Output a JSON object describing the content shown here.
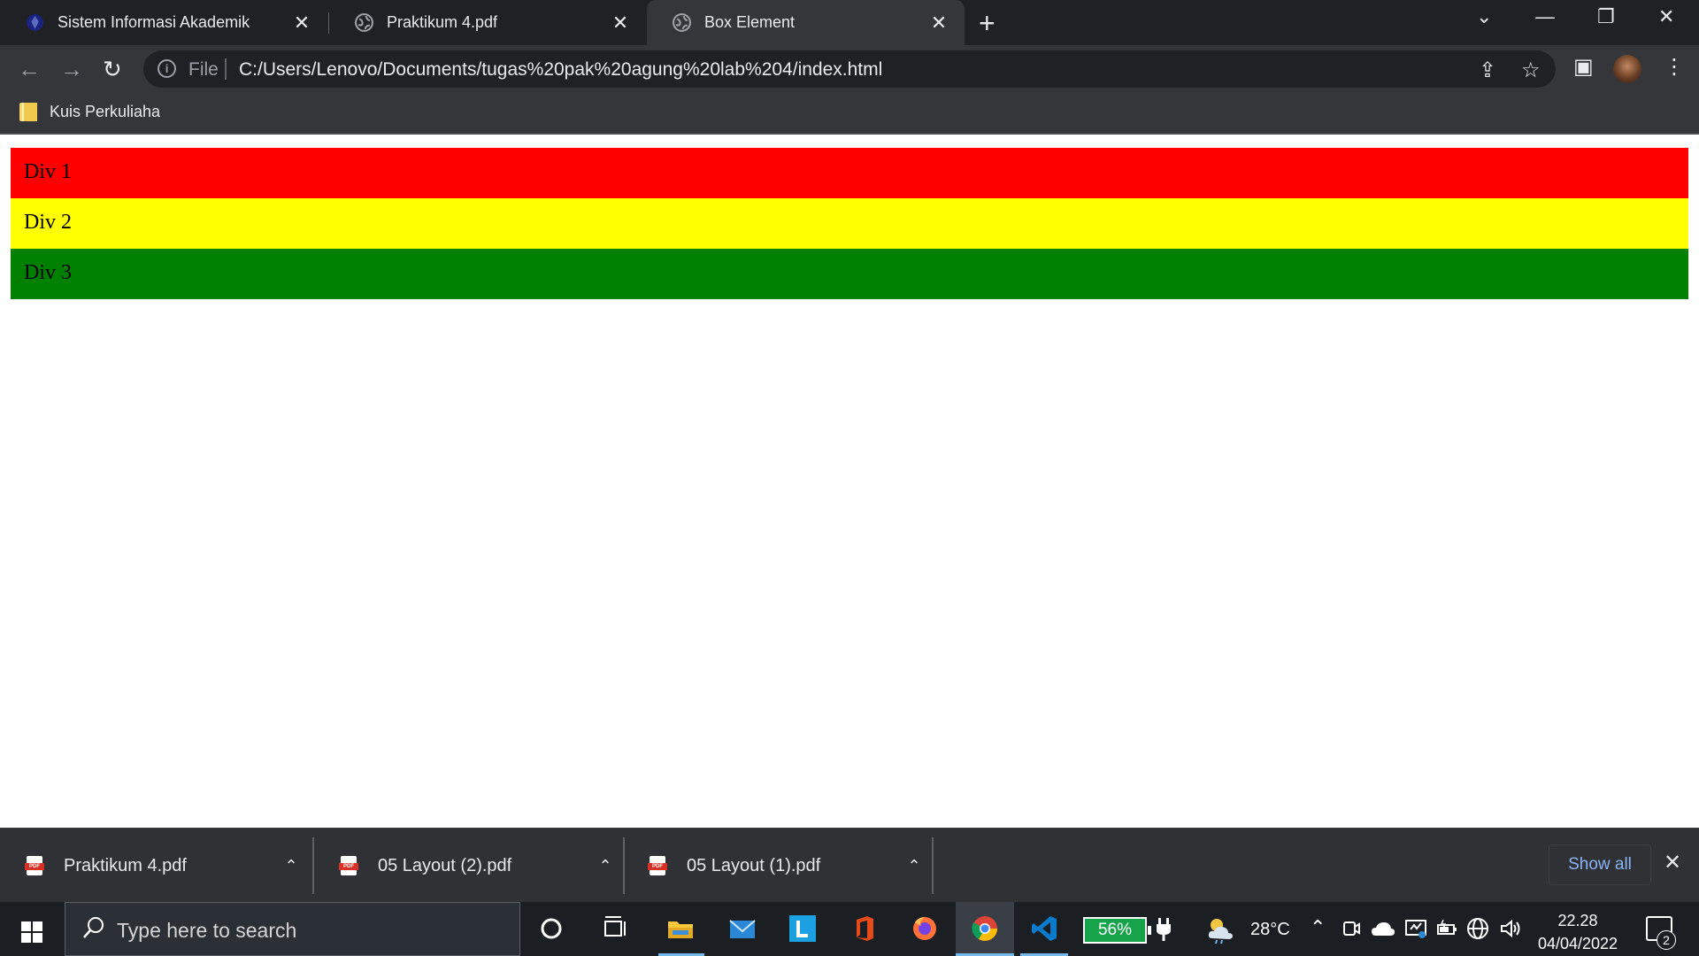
{
  "browser": {
    "tabs": [
      {
        "title": "Sistem Informasi Akademik",
        "icon": "university-logo-icon",
        "active": false
      },
      {
        "title": "Praktikum 4.pdf",
        "icon": "globe-icon",
        "active": false
      },
      {
        "title": "Box Element",
        "icon": "globe-icon",
        "active": true
      }
    ],
    "new_tab_label": "+",
    "window_controls": {
      "tab_search": "⌄",
      "minimize": "—",
      "restore": "❐",
      "close": "✕"
    }
  },
  "toolbar": {
    "back": "←",
    "forward": "→",
    "reload": "↻",
    "omnibox": {
      "scheme_label": "File",
      "url": "C:/Users/Lenovo/Documents/tugas%20pak%20agung%20lab%204/index.html"
    },
    "share_icon": "⇪",
    "bookmark_star": "☆",
    "side_panel_icon": "▣",
    "menu_icon": "⋮"
  },
  "bookmarks": [
    {
      "label": "Kuis Perkuliaha",
      "icon": "folder-icon"
    }
  ],
  "page": {
    "divs": [
      {
        "label": "Div 1",
        "color": "#ff0000"
      },
      {
        "label": "Div 2",
        "color": "#ffff00"
      },
      {
        "label": "Div 3",
        "color": "#008000"
      }
    ]
  },
  "downloads": {
    "items": [
      {
        "name": "Praktikum 4.pdf",
        "chevron": "⌃"
      },
      {
        "name": "05 Layout (2).pdf",
        "chevron": "⌃"
      },
      {
        "name": "05 Layout (1).pdf",
        "chevron": "⌃"
      }
    ],
    "show_all": "Show all",
    "close": "✕"
  },
  "taskbar": {
    "search_placeholder": "Type here to search",
    "apps": [
      "cortana-icon",
      "task-view-icon",
      "file-explorer-icon",
      "mail-icon",
      "l-app-icon",
      "office-icon",
      "firefox-icon",
      "chrome-icon",
      "vscode-icon"
    ],
    "battery_percent": "56%",
    "temperature": "28°C",
    "time": "22.28",
    "date": "04/04/2022",
    "notification_count": "2"
  }
}
